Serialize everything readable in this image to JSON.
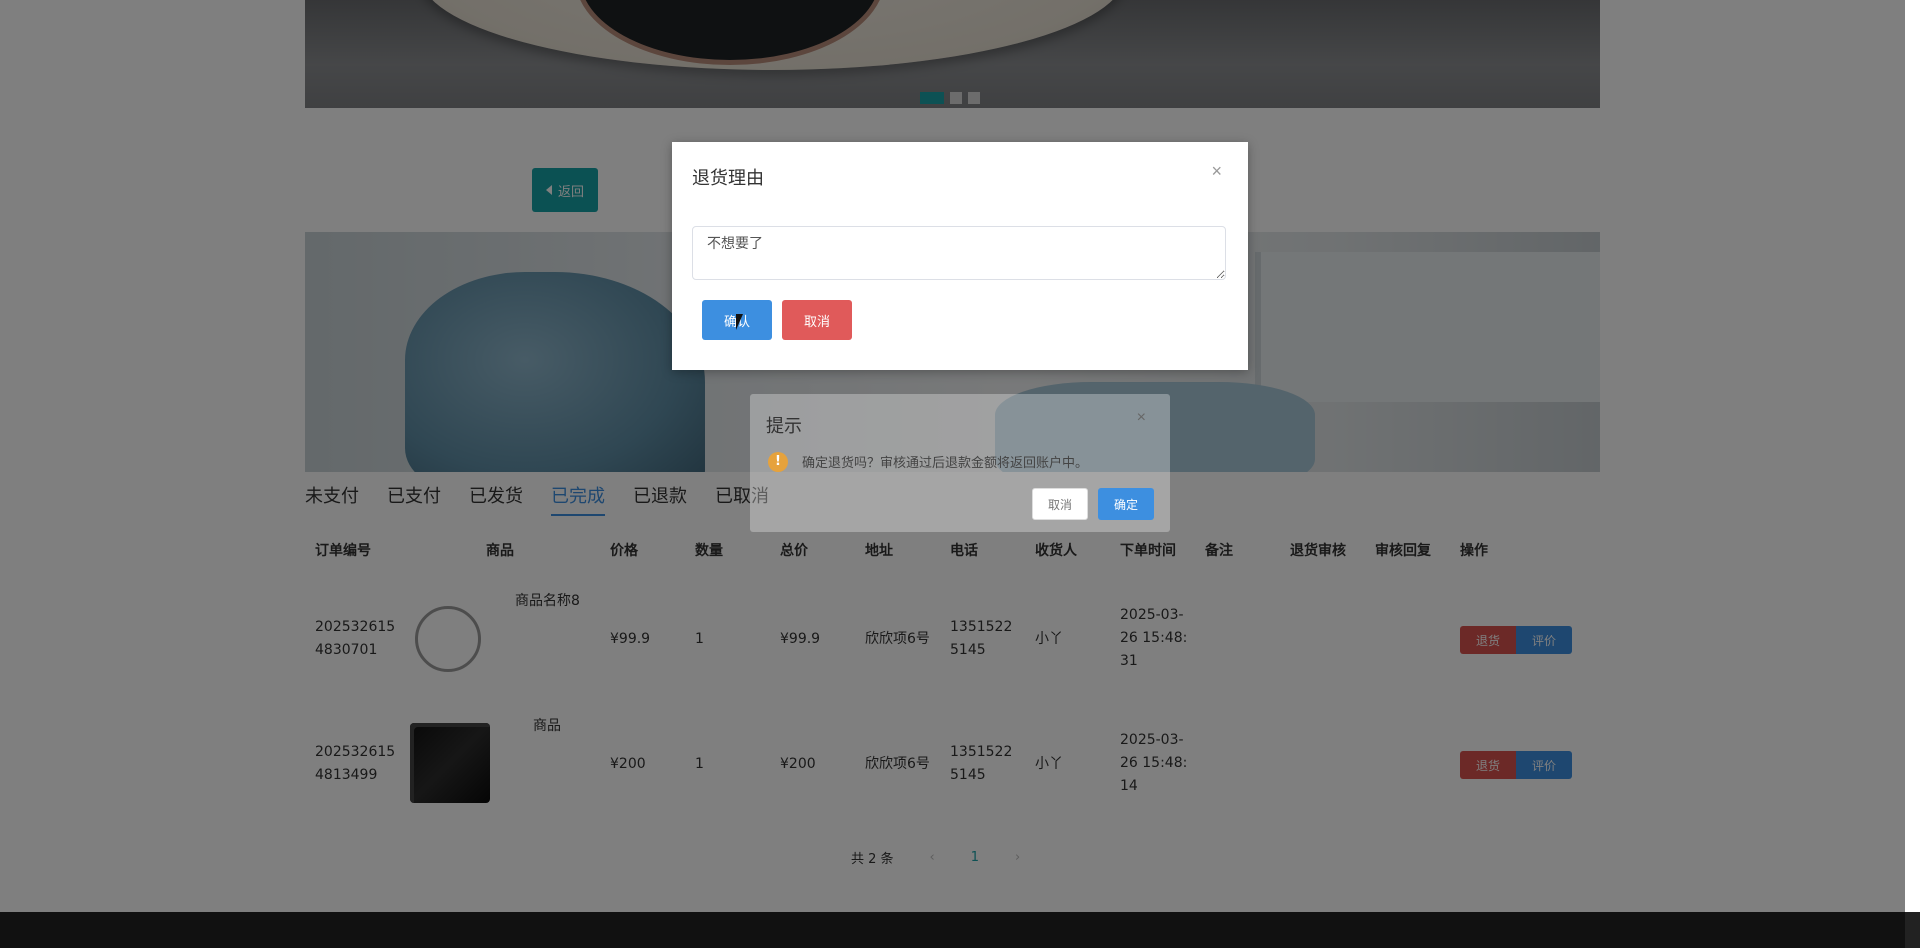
{
  "back_button_label": "返回",
  "tabs": [
    {
      "label": "未支付",
      "active": false
    },
    {
      "label": "已支付",
      "active": false
    },
    {
      "label": "已发货",
      "active": false
    },
    {
      "label": "已完成",
      "active": true
    },
    {
      "label": "已退款",
      "active": false
    },
    {
      "label": "已取消",
      "active": false
    }
  ],
  "table": {
    "headers": [
      "订单编号",
      "商品",
      "价格",
      "数量",
      "总价",
      "地址",
      "电话",
      "收货人",
      "下单时间",
      "备注",
      "退货审核",
      "审核回复",
      "操作"
    ],
    "rows": [
      {
        "order_no_1": "202532615",
        "order_no_2": "4830701",
        "product_name": "商品名称8",
        "price": "¥99.9",
        "qty": "1",
        "total": "¥99.9",
        "address": "欣欣项6号",
        "phone_1": "1351522",
        "phone_2": "5145",
        "receiver": "小丫",
        "time_1": "2025-03-",
        "time_2": "26 15:48:",
        "time_3": "31",
        "refund_label": "退货",
        "review_label": "评价"
      },
      {
        "order_no_1": "202532615",
        "order_no_2": "4813499",
        "product_name": "商品",
        "price": "¥200",
        "qty": "1",
        "total": "¥200",
        "address": "欣欣项6号",
        "phone_1": "1351522",
        "phone_2": "5145",
        "receiver": "小丫",
        "time_1": "2025-03-",
        "time_2": "26 15:48:",
        "time_3": "14",
        "refund_label": "退货",
        "review_label": "评价"
      }
    ]
  },
  "pagination": {
    "total_text": "共 2 条",
    "prev": "‹",
    "page": "1",
    "next": "›"
  },
  "reason_dialog": {
    "title": "退货理由",
    "close": "×",
    "textarea_value": "不想要了",
    "confirm_label": "确认",
    "cancel_label": "取消"
  },
  "prompt_dialog": {
    "title": "提示",
    "close": "×",
    "icon": "!",
    "message": "确定退货吗？审核通过后退款金额将返回账户中。",
    "cancel_label": "取消",
    "ok_label": "确定"
  },
  "colors": {
    "accent_teal": "#17a2a6",
    "primary_blue": "#3d8fe0",
    "danger_red": "#d9534f"
  }
}
